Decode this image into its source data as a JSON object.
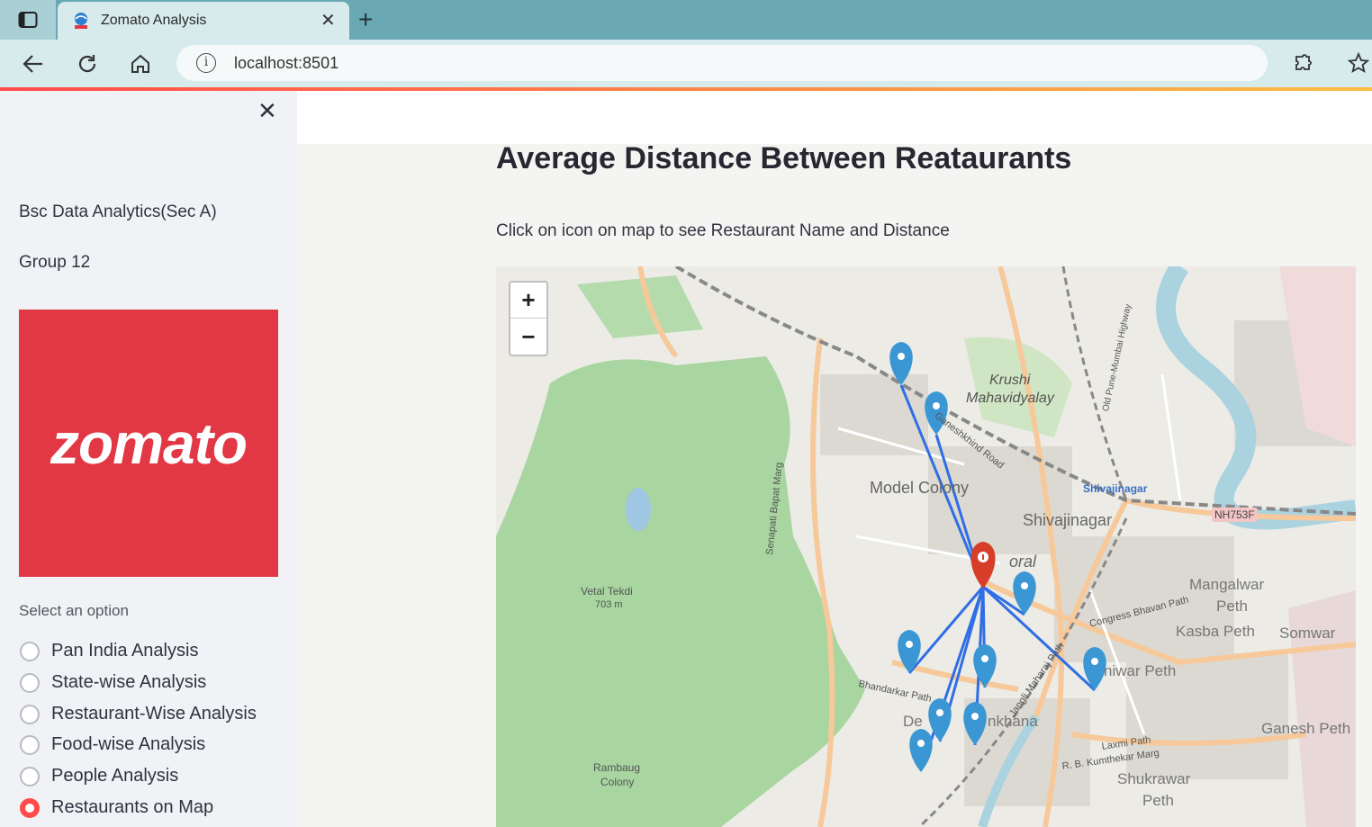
{
  "browser": {
    "tab_title": "Zomato Analysis",
    "tab_close": "✕",
    "new_tab": "+",
    "url": "localhost:8501"
  },
  "sidebar": {
    "close": "✕",
    "line1": "Bsc Data Analytics(Sec A)",
    "line2": "Group 12",
    "logo_text": "zomato",
    "select_label": "Select an option",
    "options": [
      {
        "label": "Pan India Analysis",
        "selected": false
      },
      {
        "label": "State-wise Analysis",
        "selected": false
      },
      {
        "label": "Restaurant-Wise Analysis",
        "selected": false
      },
      {
        "label": "Food-wise Analysis",
        "selected": false
      },
      {
        "label": "People Analysis",
        "selected": false
      },
      {
        "label": "Restaurants on Map",
        "selected": true
      }
    ]
  },
  "main": {
    "title": "Average Distance Between Reataurants",
    "caption": "Click on icon on map to see Restaurant Name and Distance"
  },
  "map": {
    "zoom_in": "+",
    "zoom_out": "−",
    "labels": {
      "krushi": "Krushi",
      "mahavidyalay": "Mahavidyalay",
      "model_colony": "Model Colony",
      "shivajinagar": "Shivajinagar",
      "shivajinagar_station": "Shivajinagar",
      "nh": "NH753F",
      "vetal": "Vetal Tekdi",
      "vetal_h": "703 m",
      "mangalwar": "Mangalwar",
      "peth1": "Peth",
      "kasba": "Kasba Peth",
      "somwar": "Somwar",
      "shaniwar": "niwar Peth",
      "ganesh": "Ganesh Peth",
      "shukrawar": "Shukrawar",
      "peth2": "Peth",
      "deccan": "De",
      "gymkhana": "nkhana",
      "rambaug": "Rambaug",
      "colony": "Colony",
      "bhandarkar": "Bhandarkar Path",
      "senapati": "Senapati Bapat Marg",
      "laxmi": "Laxmi Path",
      "kumthekar": "R. B. Kumthekar Marg",
      "congress": "Congress Bhavan Path",
      "jangli": "Jangli Maharaj Path",
      "ganeshkhind": "Ganeshkhind Road",
      "coral": "oral",
      "pune_mumbai": "Old Pune-Mumbai Highway"
    },
    "colors": {
      "marker_blue": "#3a97d4",
      "marker_red": "#d63e2a",
      "line": "#2f6ee5",
      "park": "#a8d5a0"
    }
  }
}
